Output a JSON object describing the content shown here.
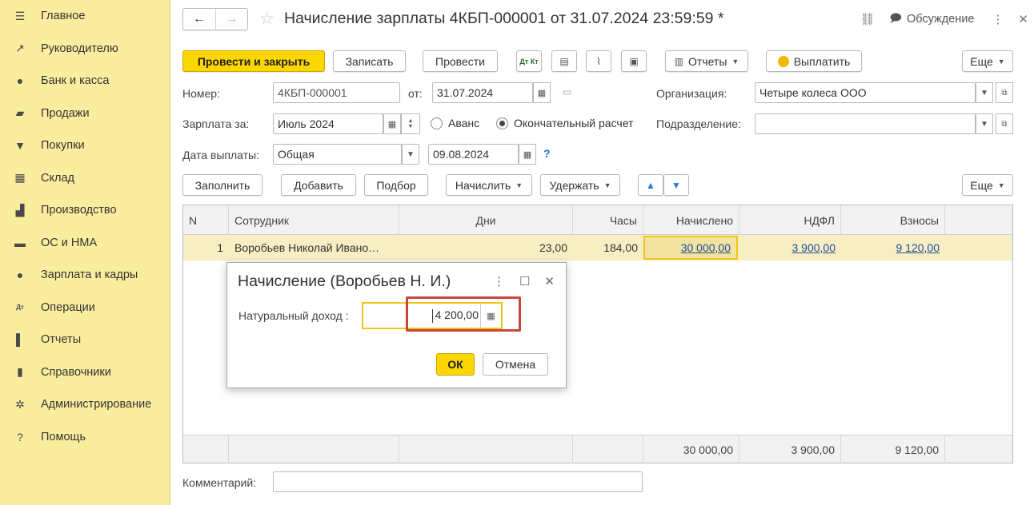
{
  "sidebar": {
    "items": [
      {
        "icon": "menu-icon",
        "glyph": "☰",
        "label": "Главное"
      },
      {
        "icon": "trend-icon",
        "glyph": "↗",
        "label": "Руководителю"
      },
      {
        "icon": "coin-icon",
        "glyph": "●",
        "label": "Банк и касса"
      },
      {
        "icon": "bag-icon",
        "glyph": "▰",
        "label": "Продажи"
      },
      {
        "icon": "cart-icon",
        "glyph": "▼",
        "label": "Покупки"
      },
      {
        "icon": "warehouse-icon",
        "glyph": "▦",
        "label": "Склад"
      },
      {
        "icon": "factory-icon",
        "glyph": "▟",
        "label": "Производство"
      },
      {
        "icon": "truck-icon",
        "glyph": "▬",
        "label": "ОС и НМА"
      },
      {
        "icon": "person-icon",
        "glyph": "●",
        "label": "Зарплата и кадры"
      },
      {
        "icon": "dt-kt-icon",
        "glyph": "Дт",
        "label": "Операции"
      },
      {
        "icon": "bar-chart-icon",
        "glyph": "▌",
        "label": "Отчеты"
      },
      {
        "icon": "books-icon",
        "glyph": "▮",
        "label": "Справочники"
      },
      {
        "icon": "gear-icon",
        "glyph": "✲",
        "label": "Администрирование"
      },
      {
        "icon": "help-icon",
        "glyph": "?",
        "label": "Помощь"
      }
    ]
  },
  "header": {
    "title": "Начисление зарплаты 4КБП-000001 от 31.07.2024 23:59:59 *",
    "back": "←",
    "forward": "→",
    "star": "☆",
    "link": "⛓",
    "discuss_icon": "🗩",
    "discuss": "Обсуждение",
    "more": "⋮",
    "close": "✕"
  },
  "toolbar": {
    "post_close": "Провести и закрыть",
    "save": "Записать",
    "post": "Провести",
    "dt_kt": "Дт Кт",
    "reports": "Отчеты",
    "pay": "Выплатить",
    "more": "Еще"
  },
  "form": {
    "number_label": "Номер:",
    "number": "4КБП-000001",
    "date_label": "от:",
    "date": "31.07.2024",
    "org_label": "Организация:",
    "org": "Четыре колеса ООО",
    "salary_for_label": "Зарплата за:",
    "salary_for": "Июль 2024",
    "advance": "Аванс",
    "final": "Окончательный расчет",
    "dept_label": "Подразделение:",
    "dept": "",
    "pay_date_label": "Дата выплаты:",
    "pay_type": "Общая",
    "pay_date": "09.08.2024",
    "help": "?",
    "comment_label": "Комментарий:",
    "comment": ""
  },
  "table_toolbar": {
    "fill": "Заполнить",
    "add": "Добавить",
    "pick": "Подбор",
    "accrue": "Начислить",
    "withhold": "Удержать",
    "more": "Еще"
  },
  "table": {
    "headers": [
      "N",
      "Сотрудник",
      "Дни",
      "Часы",
      "Начислено",
      "НДФЛ",
      "Взносы"
    ],
    "row": {
      "n": "1",
      "employee": "Воробьев Николай Ивано…",
      "days": "23,00",
      "hours": "184,00",
      "accrued": "30 000,00",
      "ndfl": "3 900,00",
      "contrib": "9 120,00"
    },
    "totals": {
      "accrued": "30 000,00",
      "ndfl": "3 900,00",
      "contrib": "9 120,00"
    }
  },
  "dialog": {
    "title": "Начисление (Воробьев Н. И.)",
    "more": "⋮",
    "maximize": "☐",
    "close": "✕",
    "field_label": "Натуральный доход :",
    "field_value": "4 200,00",
    "ok": "ОК",
    "cancel": "Отмена"
  },
  "colors": {
    "sidebar_bg": "#fbed9e",
    "primary_button": "#fcd600",
    "selected_row": "#f8eec3",
    "link": "#1c4f9c",
    "highlight_box": "#c9463d"
  }
}
